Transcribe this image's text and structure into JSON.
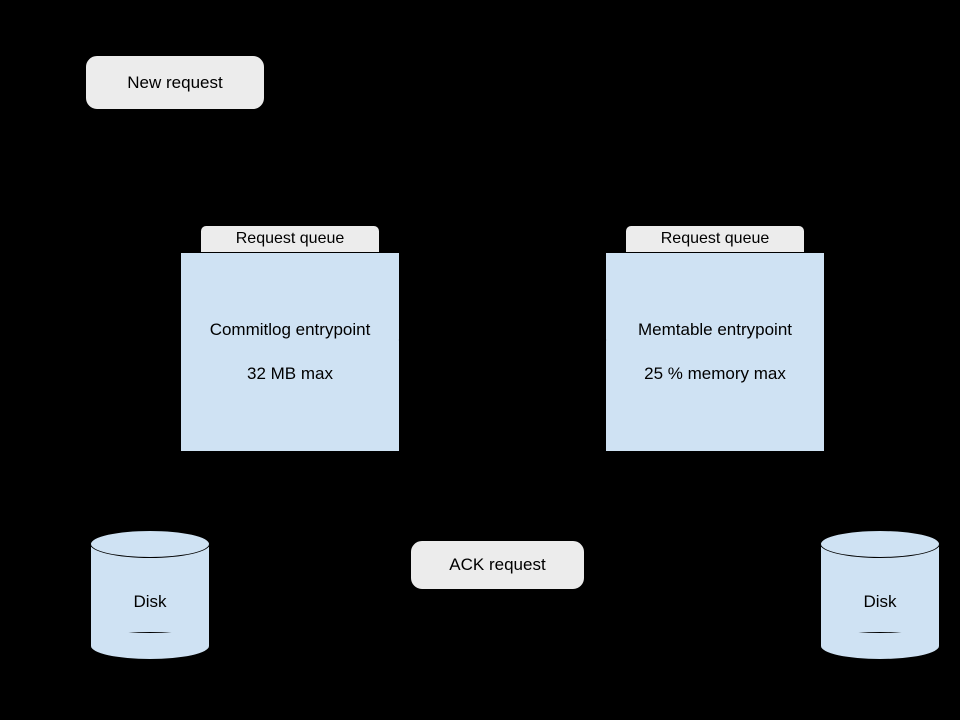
{
  "nodes": {
    "new_request": "New request",
    "ack_request": "ACK request",
    "left_queue": {
      "header": "Request queue",
      "line1": "Commitlog entrypoint",
      "line2": "32 MB max"
    },
    "right_queue": {
      "header": "Request queue",
      "line1": "Memtable entrypoint",
      "line2": "25 % memory max"
    },
    "disk_left": "Disk",
    "disk_right": "Disk"
  }
}
